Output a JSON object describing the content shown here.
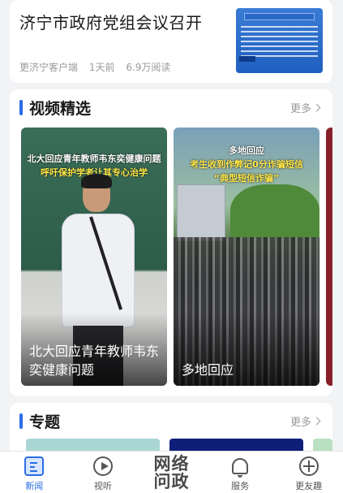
{
  "news": {
    "title": "济宁市政府党组会议召开",
    "source": "更济宁客户端",
    "time": "1天前",
    "reads": "6.9万阅读"
  },
  "video_section": {
    "title": "视频精选",
    "more": "更多",
    "items": [
      {
        "overlay_line1": "北大回应青年教师韦东奕健康问题",
        "overlay_line2": "呼吁保护学者让其专心治学",
        "title": "北大回应青年教师韦东奕健康问题"
      },
      {
        "overlay_line1": "多地回应",
        "overlay_line2": "考生收到作弊记0分诈骗短信",
        "overlay_line3": "“典型短信诈骗”",
        "title": "多地回应"
      }
    ]
  },
  "topic_section": {
    "title": "专题",
    "more": "更多"
  },
  "nav": {
    "items": [
      {
        "label": "新闻",
        "icon": "news-icon",
        "active": true
      },
      {
        "label": "视听",
        "icon": "play-icon",
        "active": false
      },
      {
        "label": "网络问政",
        "icon": "wangluo-wenzheng-logo",
        "active": false
      },
      {
        "label": "服务",
        "icon": "bell-icon",
        "active": false
      },
      {
        "label": "更友趣",
        "icon": "aperture-icon",
        "active": false
      }
    ],
    "center_line1": "网络",
    "center_line2": "问政"
  },
  "colors": {
    "accent": "#2b6de5",
    "background": "#f2f3f5"
  }
}
